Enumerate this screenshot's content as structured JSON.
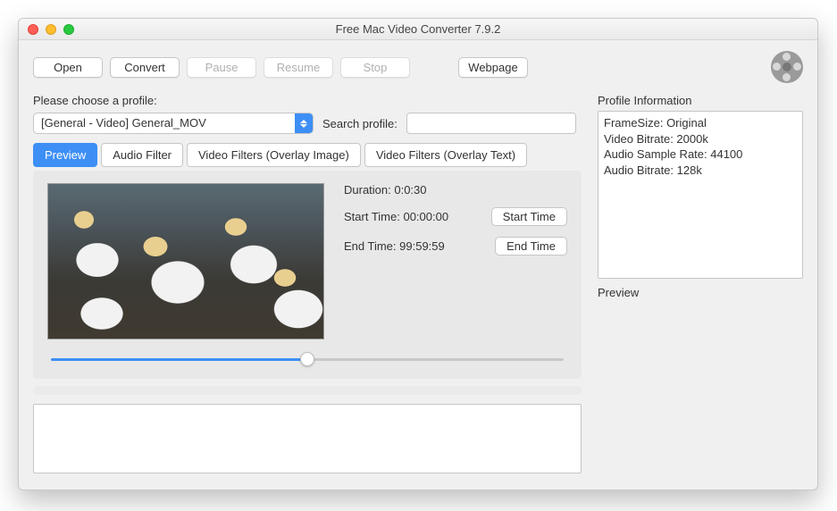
{
  "window": {
    "title": "Free Mac Video Converter 7.9.2"
  },
  "toolbar": {
    "open": "Open",
    "convert": "Convert",
    "pause": "Pause",
    "resume": "Resume",
    "stop": "Stop",
    "webpage": "Webpage"
  },
  "prompt": "Please choose a profile:",
  "profile": {
    "selected": "[General - Video] General_MOV",
    "search_label": "Search profile:",
    "search_value": ""
  },
  "tabs": {
    "preview": "Preview",
    "audio_filter": "Audio Filter",
    "video_overlay_image": "Video Filters (Overlay Image)",
    "video_overlay_text": "Video Filters (Overlay Text)"
  },
  "preview_panel": {
    "duration_label": "Duration: 0:0:30",
    "start_time_label": "Start Time: 00:00:00",
    "start_time_btn": "Start Time",
    "end_time_label": "End Time: 99:59:59",
    "end_time_btn": "End Time",
    "slider_pct": 50
  },
  "profile_info": {
    "heading": "Profile Information",
    "lines": {
      "l0": "FrameSize: Original",
      "l1": "Video Bitrate: 2000k",
      "l2": "Audio Sample Rate: 44100",
      "l3": "Audio Bitrate: 128k"
    }
  },
  "preview_label": "Preview"
}
